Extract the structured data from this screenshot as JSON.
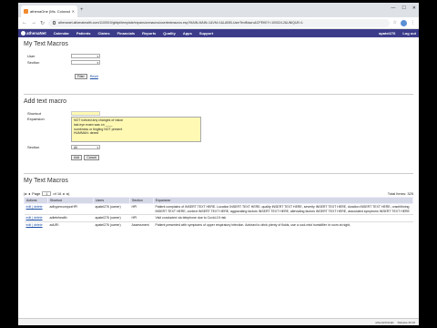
{
  "browser": {
    "tab_title": "athenaOne (Ms. Colorado)",
    "url": "athenanet.athenahealth.com/1100019/gbbpi/template/expansionmacros/usertextmacros.esp?MAIN-MAIN=1&VM=1&LABELUserTextMacro&CPEKEY=100024-2&UNIQUE=1"
  },
  "appnav": {
    "logo": "athenaNet",
    "items": [
      "Calendar",
      "Patients",
      "Claims",
      "Financials",
      "Reports",
      "Quality",
      "Apps",
      "Support"
    ],
    "user": "apatel276",
    "logout": "Log out"
  },
  "search": {
    "title": "My Text Macros",
    "user_label": "User",
    "section_label": "Section",
    "filter_button": "Filter",
    "reset_link": "Reset"
  },
  "add": {
    "title": "Add text macro",
    "shortcut_label": "Shortcut",
    "expansion_label": "Expansion",
    "expansion_lines": [
      "NOT noticed any changes of vision",
      "last eye exam was on ____",
      "numbness or tingling NOT present",
      "HUMMAN: dexed"
    ],
    "section_label": "Section",
    "section_value": "All",
    "add_button": "Add",
    "cancel_button": "Cancel"
  },
  "list": {
    "title": "My Text Macros",
    "page_prefix": "Page",
    "page_value": "1",
    "page_of": "of 16",
    "total": "Total Items: 325",
    "columns": [
      "Actions",
      "Shortcut",
      "Users",
      "Section",
      "Expansion"
    ],
    "rows": [
      {
        "actions": "edit | delete",
        "shortcut": "adhypercompzzHPI",
        "users": "apatel276 (owner)",
        "section": "HPI",
        "expansion": "Patient complains of INSERT TEXT HERE. Location INSERT TEXT HERE, quality INSERT TEXT HERE, severity INSERT TEXT HERE, duration INSERT TEXT HERE, onset/timing INSERT TEXT HERE, context INSERT TEXT HERE, aggravating factors INSERT TEXT HERE, alleviating factors INSERT TEXT HERE, associated symptoms INSERT TEXT HERE"
      },
      {
        "actions": "edit | delete",
        "shortcut": "adtelehealth",
        "users": "apatel276 (owner)",
        "section": "HPI",
        "expansion": "Visit conducted via telephone due to Covid-19 risk"
      },
      {
        "actions": "edit | delete",
        "shortcut": "adURI",
        "users": "apatel276 (owner)",
        "section": "Assessment",
        "expansion": "Patient presented with symptoms of upper respiratory infection. Advised to drink plenty of fluids, use a cool-mist humidifier in room at night,"
      }
    ]
  },
  "status": {
    "left": "athenaClinicals",
    "version": "Release 20.10"
  }
}
